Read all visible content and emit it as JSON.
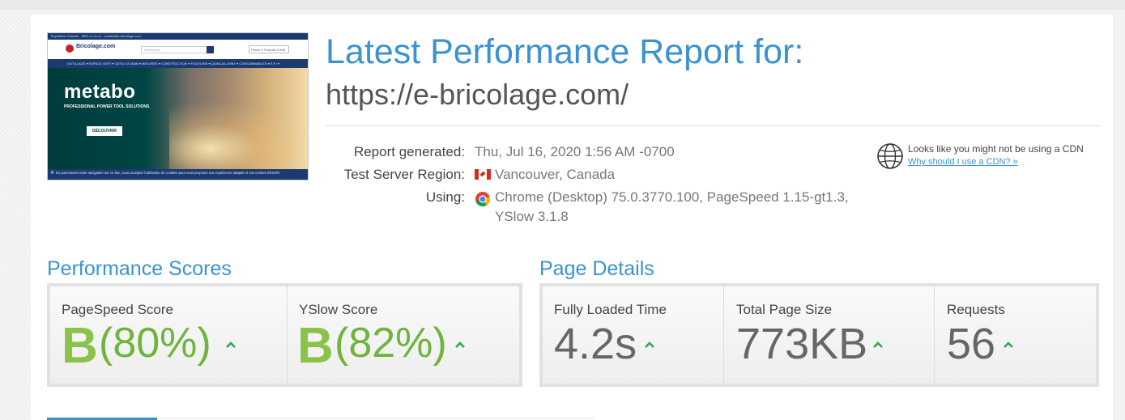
{
  "thumbnail": {
    "top_bar": "Expédition Gratuite · 0800 xx xx xx · contact@e-bricolage.com",
    "logo_text": "Bricolage.com",
    "search_placeholder": "Recherche",
    "cart_label": "Panier 0 Produits 0,00€",
    "nav_items": "OUTILLAGE ▾  ESPACE VERT ▾  OUTILS À MAIN ▾  MESURES ▾  CONSTRUCTION ▾  FIXATIONS ▾  QUINCAILLERIE ▾  CONSOMMABLES ▾  E.P.I ▾",
    "brand": "metabo",
    "tagline": "PROFESSIONAL POWER TOOL SOLUTIONS",
    "cta": "DÉCOUVRIR",
    "cookie_close": "✕",
    "cookie_notice": "En poursuivant votre navigation sur ce site, vous acceptez l'utilisation de Cookies pour vous proposer une expérience adaptée à vos centres d'intérêt."
  },
  "header": {
    "title": "Latest Performance Report for:",
    "url": "https://e-bricolage.com/"
  },
  "meta": {
    "report_generated_label": "Report generated:",
    "report_generated_value": "Thu, Jul 16, 2020 1:56 AM -0700",
    "region_label": "Test Server Region:",
    "region_value": "Vancouver, Canada",
    "using_label": "Using:",
    "using_value_line1": "Chrome (Desktop) 75.0.3770.100, PageSpeed 1.15-gt1.3,",
    "using_value_line2": "YSlow 3.1.8"
  },
  "cdn": {
    "notice": "Looks like you might not be using a CDN",
    "link": "Why should I use a CDN? »"
  },
  "performance": {
    "title": "Performance Scores",
    "pagespeed": {
      "label": "PageSpeed Score",
      "grade": "B",
      "percent": "(80%)"
    },
    "yslow": {
      "label": "YSlow Score",
      "grade": "B",
      "percent": "(82%)"
    }
  },
  "details": {
    "title": "Page Details",
    "loaded": {
      "label": "Fully Loaded Time",
      "value": "4.2s"
    },
    "size": {
      "label": "Total Page Size",
      "value": "773KB"
    },
    "requests": {
      "label": "Requests",
      "value": "56"
    }
  },
  "colors": {
    "accent": "#3a93cf",
    "grade_green": "#8bc34a",
    "caret_green": "#2fa84f",
    "text": "#555555"
  },
  "icons": {
    "cdn": "globe-icon",
    "browser": "chrome-icon",
    "region": "canada-flag-icon",
    "trend": "caret-up-icon"
  }
}
